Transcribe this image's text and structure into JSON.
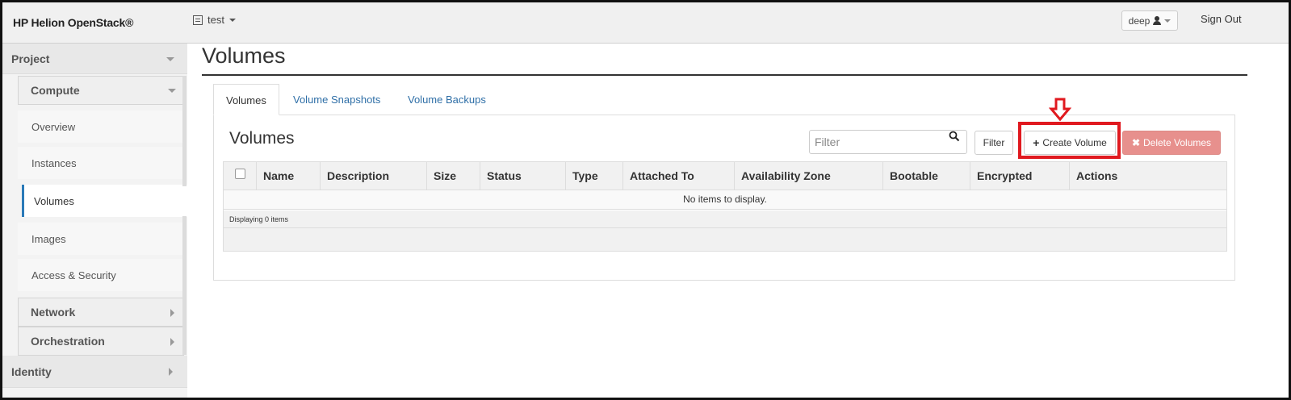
{
  "header": {
    "brand": "HP Helion OpenStack®",
    "project": "test",
    "user": "deep",
    "sign_out": "Sign Out"
  },
  "sidebar": {
    "project": "Project",
    "compute": "Compute",
    "items": [
      {
        "label": "Overview"
      },
      {
        "label": "Instances"
      },
      {
        "label": "Volumes",
        "active": true
      },
      {
        "label": "Images"
      },
      {
        "label": "Access & Security"
      }
    ],
    "network": "Network",
    "orchestration": "Orchestration",
    "identity": "Identity"
  },
  "main": {
    "page_title": "Volumes",
    "tabs": [
      {
        "label": "Volumes",
        "active": true
      },
      {
        "label": "Volume Snapshots"
      },
      {
        "label": "Volume Backups"
      }
    ],
    "panel_title": "Volumes",
    "filter_placeholder": "Filter",
    "filter_button": "Filter",
    "create_button": "Create Volume",
    "delete_button": "Delete Volumes",
    "columns": [
      "Name",
      "Description",
      "Size",
      "Status",
      "Type",
      "Attached To",
      "Availability Zone",
      "Bootable",
      "Encrypted",
      "Actions"
    ],
    "empty_message": "No items to display.",
    "footer": "Displaying 0 items"
  },
  "colors": {
    "accent_link": "#2f6fa7",
    "active_indicator": "#2a7ab8",
    "danger_button": "#e7908d",
    "highlight": "#e0191f"
  },
  "icons": {
    "project": "project-list-icon",
    "user": "user-icon",
    "search": "search-icon",
    "plus": "plus-icon",
    "delete": "x-icon",
    "annotation": "down-arrow-icon"
  }
}
